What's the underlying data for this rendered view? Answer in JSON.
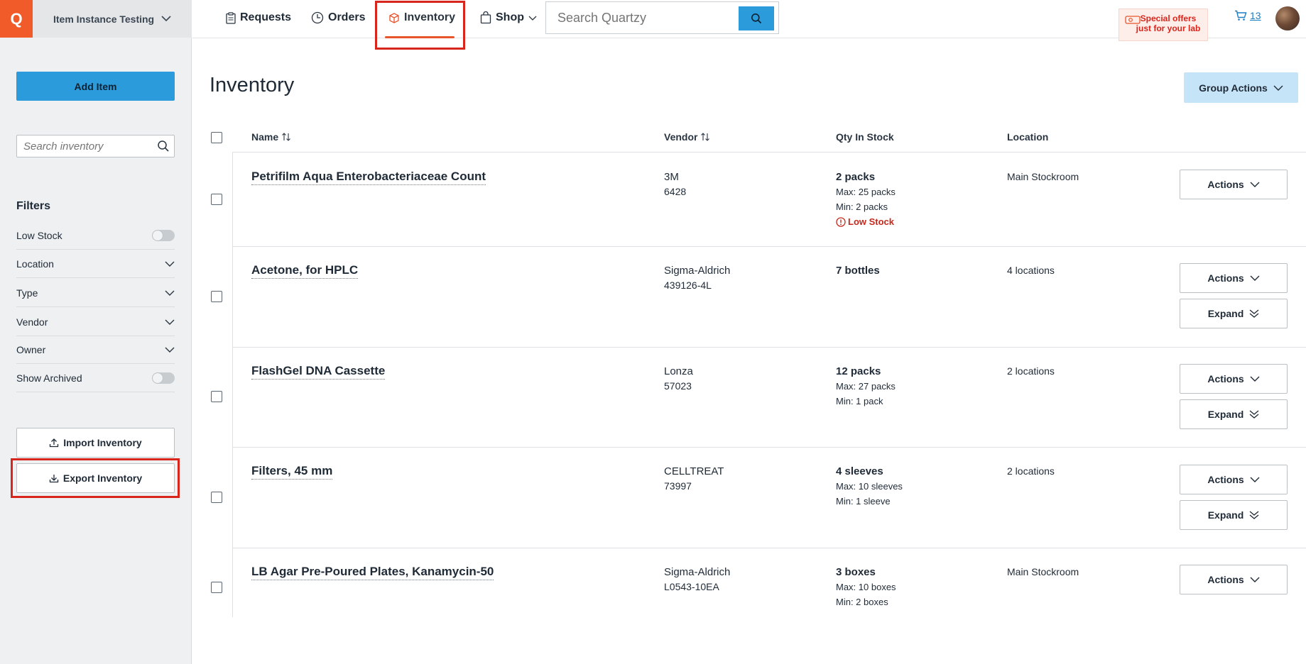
{
  "app": {
    "logo_letter": "Q",
    "workspace_name": "Item Instance Testing"
  },
  "nav": {
    "requests": "Requests",
    "orders": "Orders",
    "inventory": "Inventory",
    "shop": "Shop",
    "search_placeholder": "Search Quartzy",
    "offers_line1": "Special offers",
    "offers_line2": "just for your lab",
    "cart_count": "13"
  },
  "sidebar": {
    "add_item": "Add Item",
    "search_placeholder": "Search inventory",
    "filters_title": "Filters",
    "filters": {
      "low_stock": "Low Stock",
      "location": "Location",
      "type": "Type",
      "vendor": "Vendor",
      "owner": "Owner",
      "show_archived": "Show Archived"
    },
    "import_label": "Import Inventory",
    "export_label": "Export Inventory"
  },
  "main": {
    "title": "Inventory",
    "group_actions": "Group Actions",
    "columns": {
      "name": "Name",
      "vendor": "Vendor",
      "qty": "Qty In Stock",
      "location": "Location"
    },
    "actions_label": "Actions",
    "expand_label": "Expand",
    "items": [
      {
        "name": "Petrifilm Aqua Enterobacteriaceae Count",
        "vendor": "3M",
        "catalog": "6428",
        "qty": "2 packs",
        "max": "Max: 25 packs",
        "min": "Min: 2 packs",
        "status": "Low Stock",
        "location": "Main Stockroom"
      },
      {
        "name": "Acetone, for HPLC",
        "vendor": "Sigma-Aldrich",
        "catalog": "439126-4L",
        "qty": "7 bottles",
        "location": "4 locations"
      },
      {
        "name": "FlashGel DNA Cassette",
        "vendor": "Lonza",
        "catalog": "57023",
        "qty": "12 packs",
        "max": "Max: 27 packs",
        "min": "Min: 1 pack",
        "location": "2 locations"
      },
      {
        "name": "Filters, 45 mm",
        "vendor": "CELLTREAT",
        "catalog": "73997",
        "qty": "4 sleeves",
        "max": "Max: 10 sleeves",
        "min": "Min: 1 sleeve",
        "location": "2 locations"
      },
      {
        "name": "LB Agar Pre-Poured Plates, Kanamycin-50",
        "vendor": "Sigma-Aldrich",
        "catalog": "L0543-10EA",
        "qty": "3 boxes",
        "max": "Max: 10 boxes",
        "min": "Min: 2 boxes",
        "location": "Main Stockroom"
      }
    ]
  },
  "colors": {
    "brand": "#f15a29",
    "primary": "#2b9bdc",
    "highlight": "#d9261c",
    "warning": "#c5281c"
  }
}
